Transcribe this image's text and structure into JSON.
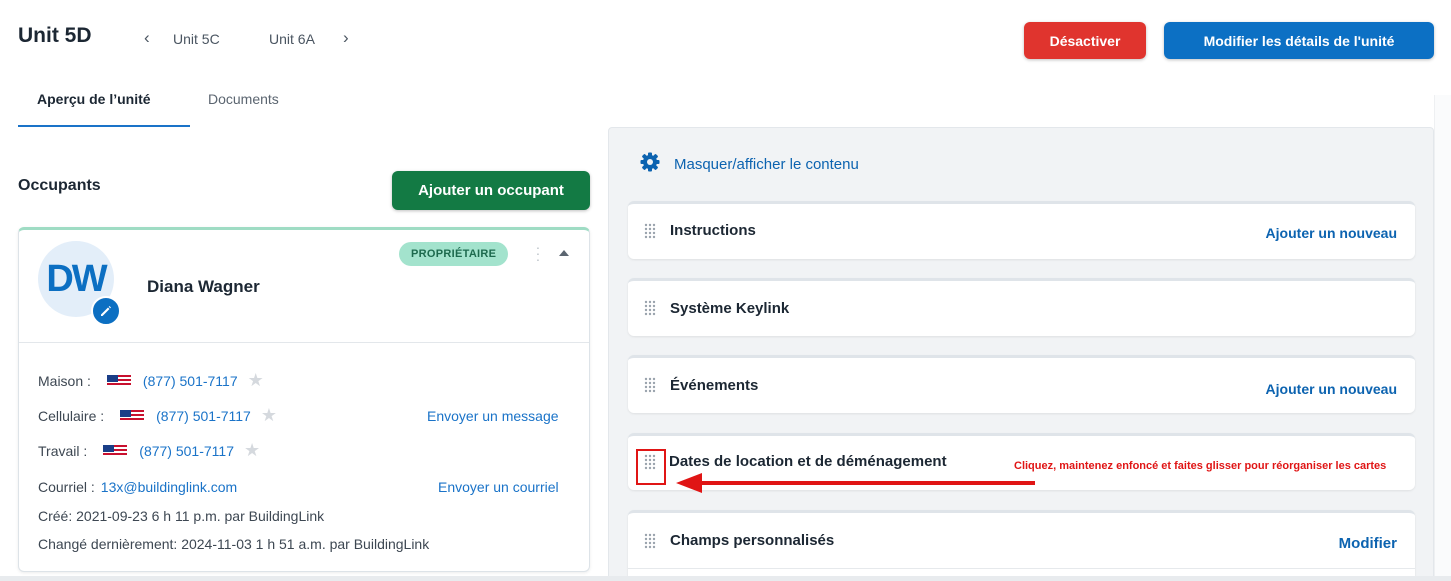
{
  "header": {
    "title": "Unit 5D",
    "prev_unit": "Unit 5C",
    "next_unit": "Unit 6A",
    "deactivate_label": "Désactiver",
    "edit_label": "Modifier les détails de l'unité"
  },
  "tabs": [
    {
      "label": "Aperçu de l’unité",
      "active": true
    },
    {
      "label": "Documents",
      "active": false
    }
  ],
  "occupants": {
    "title": "Occupants",
    "add_label": "Ajouter un occupant",
    "card": {
      "initials": "DW",
      "name": "Diana Wagner",
      "badge": "PROPRIÉTAIRE",
      "home_label": "Maison :",
      "home_phone": "(877) 501-7117",
      "cell_label": "Cellulaire :",
      "cell_phone": "(877) 501-7117",
      "send_message": "Envoyer un message",
      "work_label": "Travail :",
      "work_phone": "(877) 501-7117",
      "email_label": "Courriel :",
      "email": "13x@buildinglink.com",
      "send_email": "Envoyer un courriel",
      "created": "Créé:  2021-09-23 6 h 11 p.m. par BuildingLink",
      "changed": "Changé dernièrement:  2024-11-03 1 h 51 a.m. par BuildingLink"
    }
  },
  "sections_panel": {
    "toggle_label": "Masquer/afficher le contenu",
    "sections": [
      {
        "title": "Instructions",
        "action": "Ajouter un nouveau"
      },
      {
        "title": "Système Keylink",
        "action": ""
      },
      {
        "title": "Événements",
        "action": "Ajouter un nouveau"
      },
      {
        "title": "Dates de location et de déménagement",
        "action": ""
      },
      {
        "title": "Champs personnalisés",
        "action": "Modifier"
      }
    ],
    "hint": "Cliquez, maintenez enfoncé et faites glisser pour réorganiser les cartes"
  },
  "colors": {
    "primary": "#0c70c4",
    "danger": "#e0342e",
    "success": "#137a44",
    "badge": "#a3e3cd",
    "hint": "#e01515"
  },
  "icons": {
    "prev": "chevron-left-icon",
    "next": "chevron-right-icon",
    "toggle": "gear-icon",
    "drag": "drag-handle-icon",
    "edit_avatar": "pencil-icon",
    "favorite": "star-icon",
    "flag": "us-flag-icon"
  }
}
